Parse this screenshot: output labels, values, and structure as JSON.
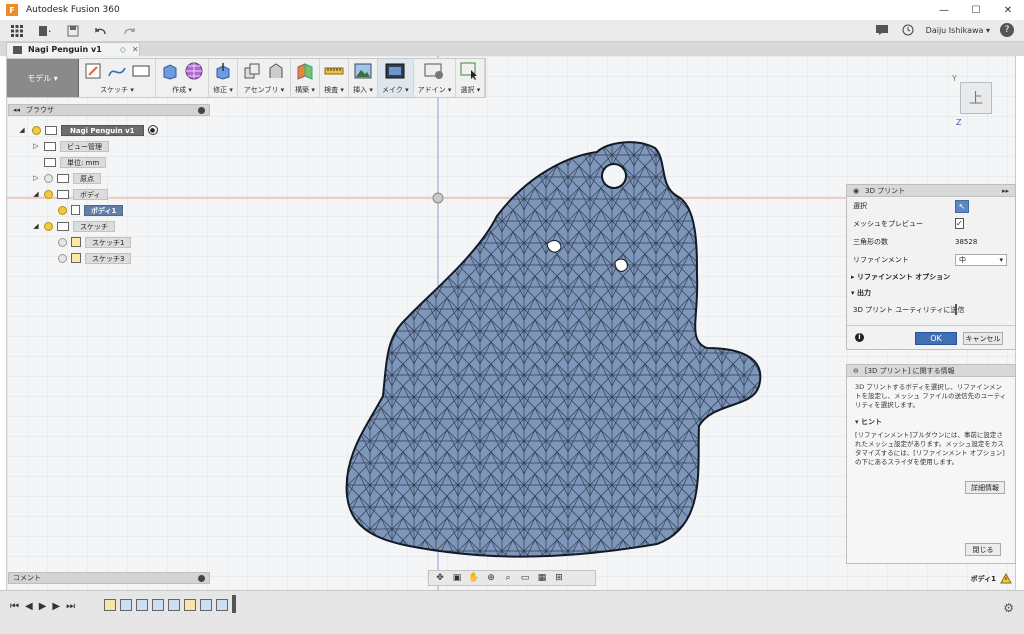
{
  "window": {
    "title": "Autodesk Fusion 360",
    "minimize": "—",
    "maximize": "☐",
    "close": "✕"
  },
  "appbar": {
    "user": "Daiju Ishikawa ▾",
    "help": "?"
  },
  "doc_tab": {
    "name": "Nagi Penguin v1"
  },
  "toolbar": {
    "workspace": "モデル ▾",
    "groups": [
      {
        "label": "スケッチ ▾"
      },
      {
        "label": "作成 ▾"
      },
      {
        "label": "修正 ▾"
      },
      {
        "label": "アセンブリ ▾"
      },
      {
        "label": "構築 ▾"
      },
      {
        "label": "検査 ▾"
      },
      {
        "label": "挿入 ▾"
      },
      {
        "label": "メイク ▾"
      },
      {
        "label": "アドイン ▾"
      },
      {
        "label": "選択 ▾"
      }
    ]
  },
  "browser": {
    "title": "ブラウザ",
    "items": [
      {
        "label": "Nagi Penguin v1"
      },
      {
        "label": "ビュー管理"
      },
      {
        "label": "単位: mm"
      },
      {
        "label": "原点"
      },
      {
        "label": "ボディ"
      },
      {
        "label": "ボディ1"
      },
      {
        "label": "スケッチ"
      },
      {
        "label": "スケッチ1"
      },
      {
        "label": "スケッチ3"
      }
    ]
  },
  "comment": {
    "title": "コメント"
  },
  "viewcube": {
    "face": "上",
    "axis_y": "Y",
    "axis_z": "Z"
  },
  "print_panel": {
    "title": "3D プリント",
    "select_label": "選択",
    "preview_label": "メッシュをプレビュー",
    "triangle_label": "三角形の数",
    "triangle_count": "38528",
    "refine_label": "リファインメント",
    "refine_value": "中",
    "refine_options": "リファインメント オプション",
    "output_label": "出力",
    "send_label": "3D プリント ユーティリティに送信",
    "ok_label": "OK",
    "cancel_label": "キャンセル"
  },
  "info_panel": {
    "title": "[3D プリント] に関する情報",
    "desc": "3D プリントするボディを選択し、リファインメントを設定し、メッシュ ファイルの送信先のユーティリティを選択します。",
    "hint_title": "ヒント",
    "hint_text": "[リファインメント]プルダウンには、事前に設定されたメッシュ設定があります。メッシュ設定をカスタマイズするには、[リファインメント オプション]の下にあるスライダを使用します。",
    "details": "詳細情報",
    "close": "閉じる"
  },
  "status": {
    "selection": "ボディ1"
  }
}
